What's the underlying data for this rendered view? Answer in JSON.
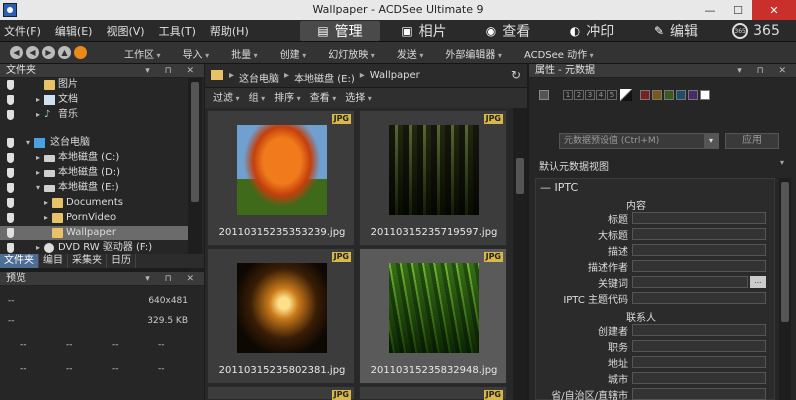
{
  "window": {
    "title": "Wallpaper - ACDSee Ultimate 9",
    "minimize": "—",
    "maximize": "☐",
    "close": "✕"
  },
  "menu": [
    "文件(F)",
    "编辑(E)",
    "视图(V)",
    "工具(T)",
    "帮助(H)"
  ],
  "modes": [
    {
      "label": "管理",
      "icon": "▤"
    },
    {
      "label": "相片",
      "icon": "▣"
    },
    {
      "label": "查看",
      "icon": "◉"
    },
    {
      "label": "冲印",
      "icon": "◐"
    },
    {
      "label": "编辑",
      "icon": "✎"
    }
  ],
  "mode365": {
    "label": "365",
    "badge": "365"
  },
  "nav_icons": [
    "◀",
    "◀",
    "▶",
    "▲"
  ],
  "toolbar": [
    "工作区",
    "导入",
    "批量",
    "创建",
    "幻灯放映",
    "发送",
    "外部编辑器",
    "ACDSee 动作"
  ],
  "folders": {
    "title": "文件夹",
    "controls": "▾ ⊓ ✕",
    "tree": [
      {
        "label": "图片",
        "icon": "folder",
        "expander": ""
      },
      {
        "label": "文档",
        "icon": "doc",
        "expander": "▸"
      },
      {
        "label": "音乐",
        "icon": "music",
        "expander": "▸"
      },
      {
        "label": "这台电脑",
        "icon": "pc",
        "expander": "▾"
      },
      {
        "label": "本地磁盘 (C:)",
        "icon": "disk",
        "expander": "▸"
      },
      {
        "label": "本地磁盘 (D:)",
        "icon": "disk",
        "expander": "▸"
      },
      {
        "label": "本地磁盘 (E:)",
        "icon": "disk",
        "expander": "▾"
      },
      {
        "label": "Documents",
        "icon": "folder",
        "expander": "▸"
      },
      {
        "label": "PornVideo",
        "icon": "folder",
        "expander": "▸"
      },
      {
        "label": "Wallpaper",
        "icon": "folder",
        "expander": ""
      },
      {
        "label": "DVD RW 驱动器 (F:)",
        "icon": "dvd",
        "expander": "▸"
      }
    ],
    "selected_index": 9
  },
  "side_tabs": [
    "文件夹",
    "编目",
    "采集夹",
    "日历"
  ],
  "preview": {
    "title": "预览",
    "controls": "▾ ⊓ ✕",
    "dimensions": "640x481",
    "size": "329.5 KB",
    "placeholder": "--"
  },
  "breadcrumb": {
    "parts": [
      "这台电脑",
      "本地磁盘 (E:)",
      "Wallpaper"
    ],
    "refresh_icon": "↻"
  },
  "filters": [
    "过滤",
    "组",
    "排序",
    "查看",
    "选择"
  ],
  "files": [
    {
      "name": "20110315235353239.jpg",
      "badge": "JPG",
      "art": "img-tree"
    },
    {
      "name": "20110315235719597.jpg",
      "badge": "JPG",
      "art": "img-forest"
    },
    {
      "name": "20110315235802381.jpg",
      "badge": "JPG",
      "art": "img-light"
    },
    {
      "name": "20110315235832948.jpg",
      "badge": "JPG",
      "art": "img-bamboo"
    }
  ],
  "more_badges": [
    "JPG",
    "JPG"
  ],
  "properties": {
    "title": "属性 - 元数据",
    "controls": "▾ ⊓ ✕",
    "rating_numbers": [
      "1",
      "2",
      "3",
      "4",
      "5"
    ],
    "label_colors": [
      "#7a2020",
      "#7a5a1a",
      "#3a5a20",
      "#1e4e6a",
      "#4a2a6a",
      "#ffffff"
    ],
    "preset_placeholder": "元数据预设值 (Ctrl+M)",
    "apply_label": "应用",
    "view_label": "默认元数据视图",
    "section": "IPTC",
    "group1": "内容",
    "group2": "联系人",
    "fields1": [
      "标题",
      "大标题",
      "描述",
      "描述作者",
      "关键词",
      "IPTC 主题代码"
    ],
    "fields2": [
      "创建者",
      "职务",
      "地址",
      "城市",
      "省/自治区/直辖市"
    ],
    "ellipsis": "..."
  }
}
